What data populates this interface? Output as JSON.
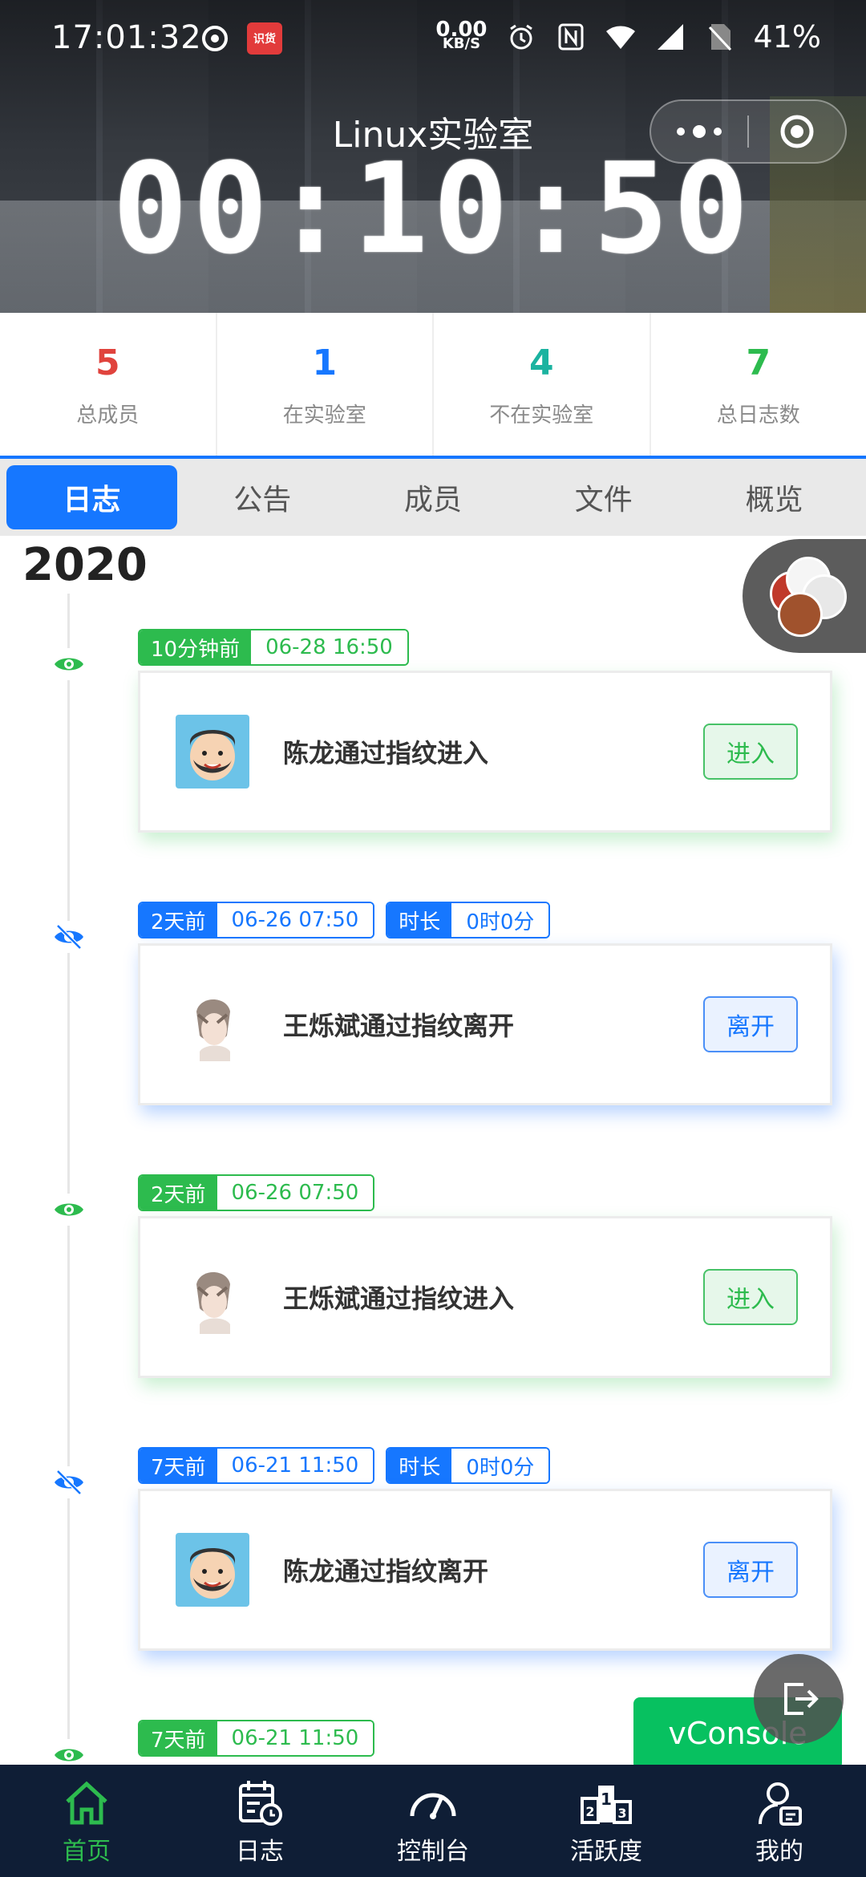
{
  "status_bar": {
    "time": "17:01:32",
    "net_speed_value": "0.00",
    "net_speed_unit": "KB/S",
    "battery": "41%",
    "badge_text": "识货"
  },
  "header": {
    "title": "Linux实验室",
    "timer": "00:10:50"
  },
  "stats": [
    {
      "value": "5",
      "label": "总成员",
      "color": "#e0433d"
    },
    {
      "value": "1",
      "label": "在实验室",
      "color": "#1677ff"
    },
    {
      "value": "4",
      "label": "不在实验室",
      "color": "#1bb3a0"
    },
    {
      "value": "7",
      "label": "总日志数",
      "color": "#2dbb4e"
    }
  ],
  "tabs": [
    "日志",
    "公告",
    "成员",
    "文件",
    "概览"
  ],
  "year": "2020",
  "entries": [
    {
      "ago": "10分钟前",
      "datetime": "06-28 16:50",
      "text": "陈龙通过指纹进入",
      "action": "进入",
      "type": "in"
    },
    {
      "ago": "2天前",
      "datetime": "06-26 07:50",
      "duration_label": "时长",
      "duration": "0时0分",
      "text": "王烁斌通过指纹离开",
      "action": "离开",
      "type": "out"
    },
    {
      "ago": "2天前",
      "datetime": "06-26 07:50",
      "text": "王烁斌通过指纹进入",
      "action": "进入",
      "type": "in"
    },
    {
      "ago": "7天前",
      "datetime": "06-21 11:50",
      "duration_label": "时长",
      "duration": "0时0分",
      "text": "陈龙通过指纹离开",
      "action": "离开",
      "type": "out"
    },
    {
      "ago": "7天前",
      "datetime": "06-21 11:50"
    }
  ],
  "vconsole_label": "vConsole",
  "bottom_nav": [
    "首页",
    "日志",
    "控制台",
    "活跃度",
    "我的"
  ]
}
